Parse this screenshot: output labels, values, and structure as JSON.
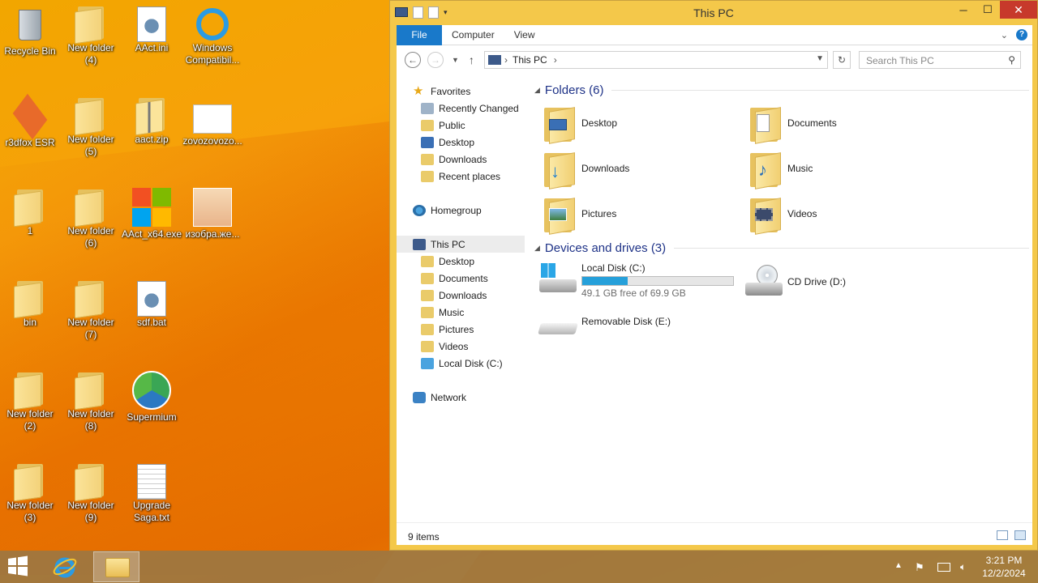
{
  "desktop": {
    "icons": [
      {
        "label": "Recycle Bin",
        "type": "recycle"
      },
      {
        "label": "New folder (4)",
        "type": "folder"
      },
      {
        "label": "AAct.ini",
        "type": "settings"
      },
      {
        "label": "Windows Compatibil...",
        "type": "ie"
      },
      {
        "label": "r3dfox ESR",
        "type": "fox"
      },
      {
        "label": "New folder (5)",
        "type": "folder"
      },
      {
        "label": "aact.zip",
        "type": "zip"
      },
      {
        "label": "zovozovozo...",
        "type": "image"
      },
      {
        "label": "1",
        "type": "folder"
      },
      {
        "label": "New folder (6)",
        "type": "folder"
      },
      {
        "label": "AAct_x64.exe",
        "type": "windows"
      },
      {
        "label": "изобра.же...",
        "type": "anime"
      },
      {
        "label": "bin",
        "type": "folder"
      },
      {
        "label": "New folder (7)",
        "type": "folder"
      },
      {
        "label": "sdf.bat",
        "type": "settings"
      },
      {
        "label": "New folder (2)",
        "type": "folder"
      },
      {
        "label": "New folder (8)",
        "type": "folder"
      },
      {
        "label": "Supermium",
        "type": "chrome"
      },
      {
        "label": "New folder (3)",
        "type": "folder"
      },
      {
        "label": "New folder (9)",
        "type": "folder"
      },
      {
        "label": "Upgrade Saga.txt",
        "type": "text"
      }
    ]
  },
  "window": {
    "title": "This PC",
    "ribbon_tabs": [
      "File",
      "Computer",
      "View"
    ],
    "address_location": "This PC",
    "search_placeholder": "Search This PC",
    "nav": {
      "favorites": "Favorites",
      "fav_items": [
        "Recently Changed",
        "Public",
        "Desktop",
        "Downloads",
        "Recent places"
      ],
      "homegroup": "Homegroup",
      "this_pc": "This PC",
      "pc_items": [
        "Desktop",
        "Documents",
        "Downloads",
        "Music",
        "Pictures",
        "Videos",
        "Local Disk (C:)"
      ],
      "network": "Network"
    },
    "folders_header": "Folders (6)",
    "folders": [
      "Desktop",
      "Documents",
      "Downloads",
      "Music",
      "Pictures",
      "Videos"
    ],
    "drives_header": "Devices and drives (3)",
    "drives": [
      {
        "name": "Local Disk (C:)",
        "free_text": "49.1 GB free of 69.9 GB",
        "used_fraction": 0.3
      },
      {
        "name": "CD Drive (D:)"
      },
      {
        "name": "Removable Disk (E:)"
      }
    ],
    "status_count": "9 items"
  },
  "taskbar": {
    "time": "3:21 PM",
    "date": "12/2/2024"
  },
  "colors": {
    "accent": "#1979ca",
    "title_bar": "#f4c84a",
    "drive_fill": "#26a0da",
    "group_header": "#1e3287"
  }
}
